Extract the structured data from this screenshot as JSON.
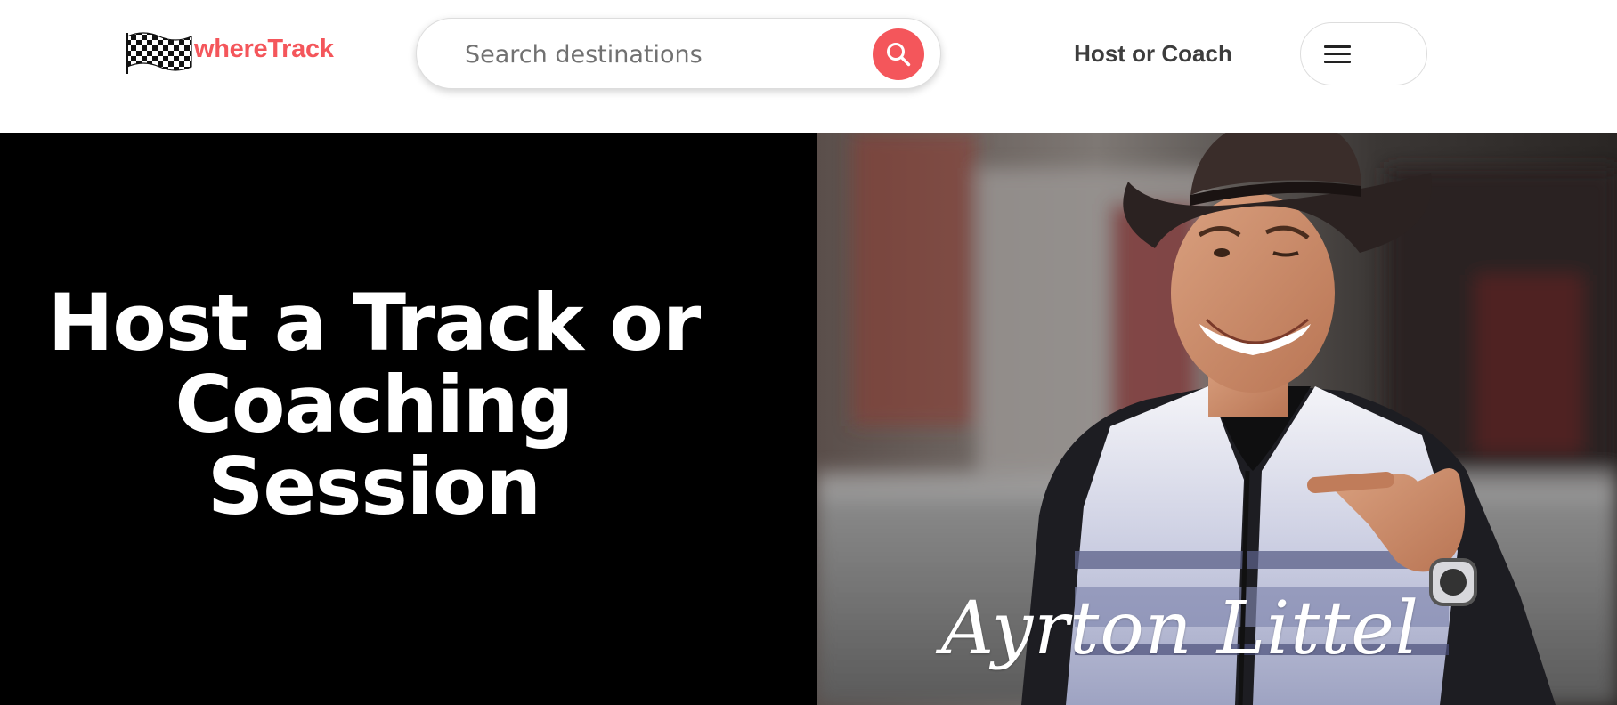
{
  "brand": {
    "name": "whereTrack",
    "accent_color": "#f4565b"
  },
  "header": {
    "logo_icon": "checkered-flag-icon",
    "search": {
      "placeholder": "Search destinations",
      "value": "",
      "button_icon": "search-icon"
    },
    "host_link_label": "Host or Coach",
    "menu_icon": "hamburger-menu-icon"
  },
  "hero": {
    "title": "Host a Track or Coaching Session",
    "background_color": "#000000",
    "photo": {
      "subject": "smiling driver in cowboy hat and racing jacket",
      "signature": "Ayrton Littel"
    }
  }
}
